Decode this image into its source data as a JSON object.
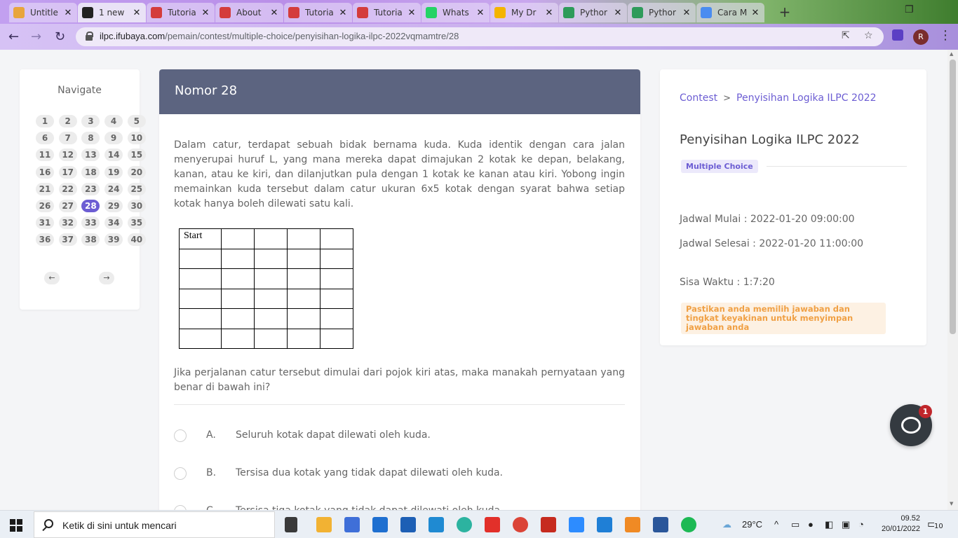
{
  "browser": {
    "tabs": [
      {
        "label": "Untitle",
        "color": "#e8a53c"
      },
      {
        "label": "1 new",
        "color": "#222222",
        "active": true
      },
      {
        "label": "Tutoria",
        "color": "#d43c3c"
      },
      {
        "label": "About",
        "color": "#d43c3c"
      },
      {
        "label": "Tutoria",
        "color": "#d43c3c"
      },
      {
        "label": "Tutoria",
        "color": "#d43c3c"
      },
      {
        "label": "Whats",
        "color": "#25d366"
      },
      {
        "label": "My Dr",
        "color": "#f4b400"
      },
      {
        "label": "Pythor",
        "color": "#2e9b5a"
      },
      {
        "label": "Pythor",
        "color": "#2e9b5a"
      },
      {
        "label": "Cara M",
        "color": "#4a8cf0"
      }
    ],
    "url_host": "ilpc.ifubaya.com",
    "url_path": "/pemain/contest/multiple-choice/penyisihan-logika-ilpc-2022vqmamtre/28",
    "profile_initial": "R"
  },
  "nav": {
    "title": "Navigate",
    "numbers": [
      "1",
      "2",
      "3",
      "4",
      "5",
      "6",
      "7",
      "8",
      "9",
      "10",
      "11",
      "12",
      "13",
      "14",
      "15",
      "16",
      "17",
      "18",
      "19",
      "20",
      "21",
      "22",
      "23",
      "24",
      "25",
      "26",
      "27",
      "28",
      "29",
      "30",
      "31",
      "32",
      "33",
      "34",
      "35",
      "36",
      "37",
      "38",
      "39",
      "40"
    ],
    "active": "28",
    "prev": "←",
    "next": "→"
  },
  "question": {
    "header": "Nomor 28",
    "paragraph": "Dalam catur, terdapat sebuah bidak bernama kuda. Kuda identik dengan cara jalan menyerupai huruf L, yang mana mereka dapat dimajukan 2 kotak ke depan, belakang, kanan, atau ke kiri, dan dilanjutkan pula dengan 1 kotak ke kanan atau kiri. Yobong ingin memainkan kuda tersebut dalam catur ukuran 6x5 kotak dengan syarat bahwa setiap kotak hanya boleh dilewati satu kali.",
    "board_start": "Start",
    "prompt": "Jika perjalanan catur tersebut dimulai dari pojok kiri atas, maka manakah pernyataan yang benar di bawah ini?",
    "options": [
      {
        "letter": "A.",
        "text": "Seluruh kotak dapat dilewati oleh kuda."
      },
      {
        "letter": "B.",
        "text": "Tersisa dua kotak yang tidak dapat dilewati oleh kuda."
      },
      {
        "letter": "C.",
        "text": "Tersisa tiga kotak yang tidak dapat dilewati oleh kuda."
      }
    ]
  },
  "info": {
    "breadcrumb_root": "Contest",
    "breadcrumb_current": "Penyisihan Logika ILPC 2022",
    "title": "Penyisihan Logika ILPC 2022",
    "badge": "Multiple Choice",
    "start": "Jadwal Mulai : 2022-01-20 09:00:00",
    "end": "Jadwal Selesai : 2022-01-20 11:00:00",
    "remaining": "Sisa Waktu : 1:7:20",
    "warning": "Pastikan anda memilih jawaban dan tingkat keyakinan untuk menyimpan jawaban anda"
  },
  "chat": {
    "badge": "1"
  },
  "taskbar": {
    "search_placeholder": "Ketik di sini untuk mencari",
    "weather": "29°C",
    "time": "09.52",
    "date": "20/01/2022",
    "notifications": "10"
  },
  "colors": {
    "accent": "#6c5dd3",
    "header": "#5c6480",
    "warning": "#f0a044"
  }
}
